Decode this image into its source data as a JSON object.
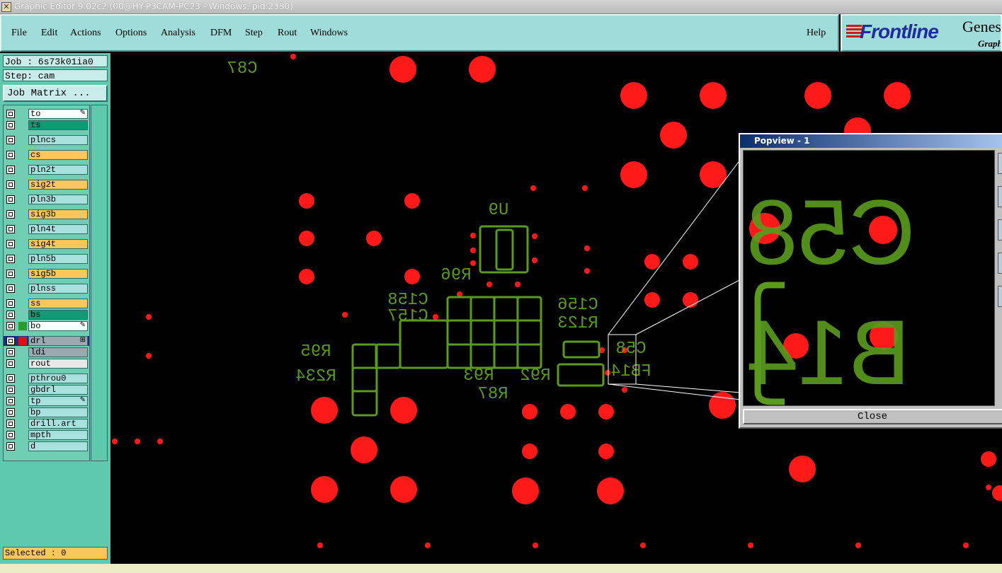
{
  "window": {
    "title": "Graphic Editor 9.02c2 (00@HY-P3CAM-PC23 - Windows, pid:2380)"
  },
  "menu": {
    "items": [
      "File",
      "Edit",
      "Actions",
      "Options",
      "Analysis",
      "DFM",
      "Step",
      "Rout",
      "Windows"
    ],
    "help": "Help"
  },
  "logo": {
    "brand": "Frontline",
    "product": "Genes",
    "sub": "Graph"
  },
  "job": {
    "job_label": "Job : 6s73k01ia0",
    "step_label": "Step: cam",
    "matrix_button": "Job Matrix ..."
  },
  "layers": [
    {
      "name": "to",
      "color": "#ffffff",
      "flag": "✎"
    },
    {
      "name": "ts",
      "color": "#0e9a72"
    },
    {
      "name": "plncs",
      "color": "#a8e0de"
    },
    {
      "name": "cs",
      "color": "#f8c65a"
    },
    {
      "name": "pln2t",
      "color": "#a8e0de"
    },
    {
      "name": "sig2t",
      "color": "#f8c65a"
    },
    {
      "name": "pln3b",
      "color": "#a8e0de"
    },
    {
      "name": "sig3b",
      "color": "#f8c65a"
    },
    {
      "name": "pln4t",
      "color": "#a8e0de"
    },
    {
      "name": "sig4t",
      "color": "#f8c65a"
    },
    {
      "name": "pln5b",
      "color": "#a8e0de"
    },
    {
      "name": "sig5b",
      "color": "#f8c65a"
    },
    {
      "name": "plnss",
      "color": "#a8e0de"
    },
    {
      "name": "ss",
      "color": "#f8c65a"
    },
    {
      "name": "bs",
      "color": "#0e9a72"
    },
    {
      "name": "bo",
      "color": "#ffffff",
      "flag": "✎",
      "mark": "#2e9a2e"
    },
    {
      "name": "drl",
      "color": "#9aa8b0",
      "flag": "⊞",
      "mark": "#e01010",
      "selected": true
    },
    {
      "name": "ldi",
      "color": "#9aa8b0"
    },
    {
      "name": "rout",
      "color": "#e8e8e8"
    },
    {
      "name": "pthrou0",
      "color": "#a8e0de"
    },
    {
      "name": "gbdrl",
      "color": "#a8e0de"
    },
    {
      "name": "tp",
      "color": "#a8e0de",
      "flag": "✎"
    },
    {
      "name": "bp",
      "color": "#a8e0de"
    },
    {
      "name": "drill.art",
      "color": "#a8e0de"
    },
    {
      "name": "mpth",
      "color": "#a8e0de"
    },
    {
      "name": "d",
      "color": "#a8e0de"
    }
  ],
  "status": {
    "selected": "Selected : 0"
  },
  "canvas": {
    "labels": [
      "C87",
      "U9",
      "R96",
      "C158",
      "C157",
      "C156",
      "R123",
      "R95",
      "R234",
      "R93",
      "R92",
      "R87",
      "C58",
      "FB14"
    ]
  },
  "popview": {
    "title": "Popview - 1",
    "close_label": "Close",
    "zoom_text_top": "C58",
    "zoom_text_bottom": "B14"
  },
  "colors": {
    "pad": "#ff1a1a",
    "silk": "#5a9a1e",
    "menu_bg": "#9fdcda",
    "panel_bg": "#5ec9ad"
  }
}
